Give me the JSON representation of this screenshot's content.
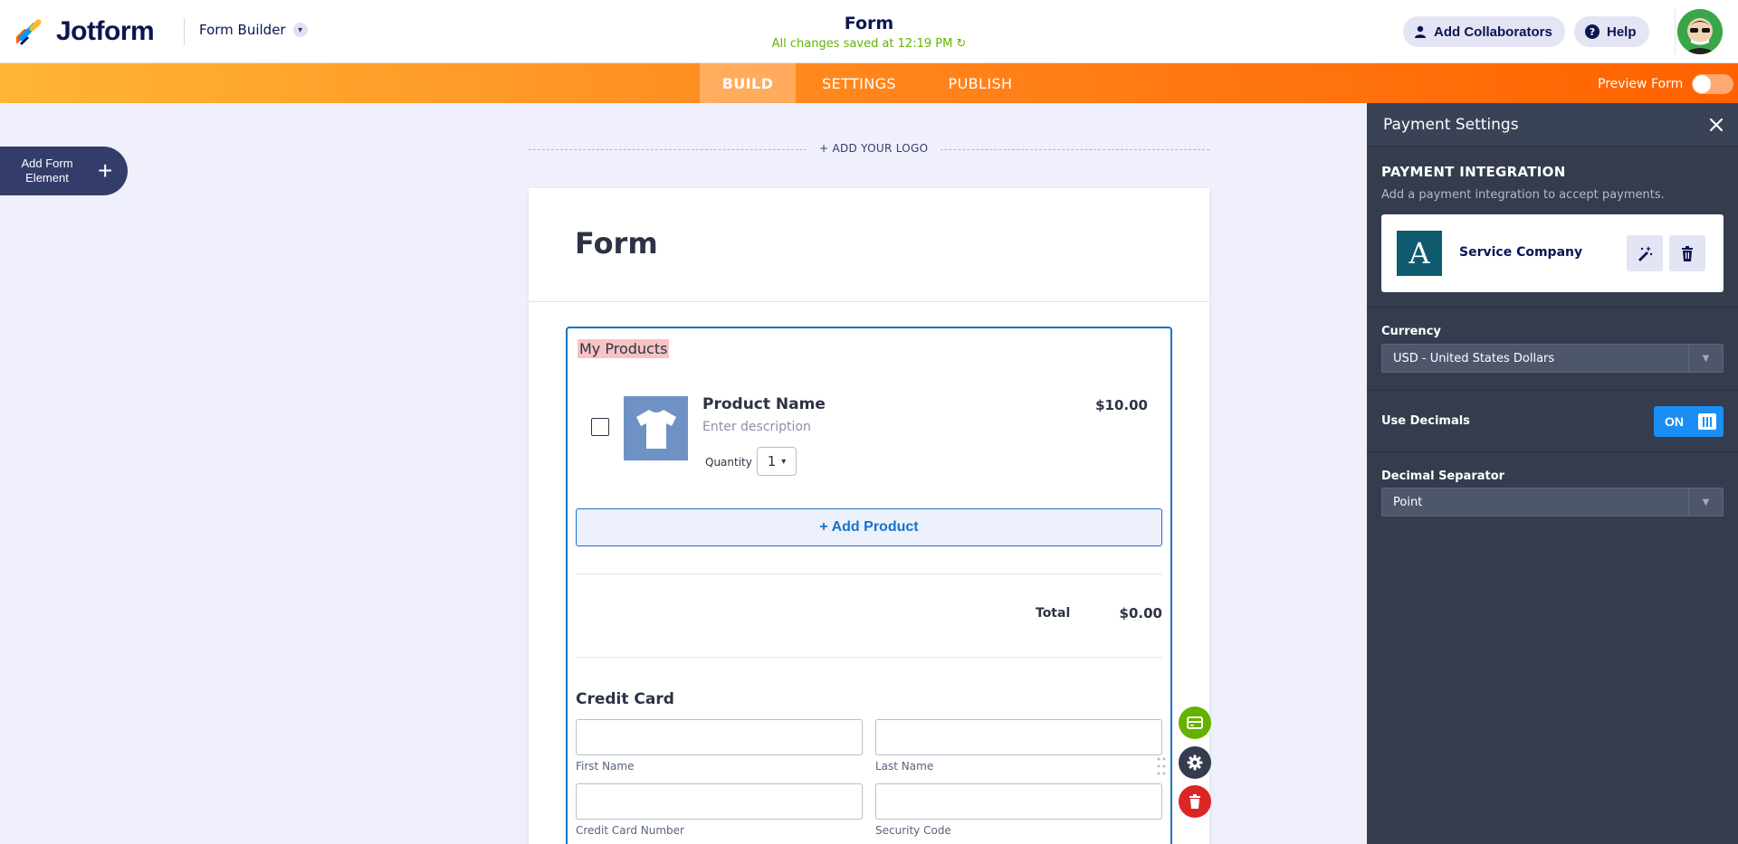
{
  "header": {
    "brand": "Jotform",
    "builder_menu": "Form Builder",
    "form_title": "Form",
    "saved_status": "All changes saved at 12:19 PM",
    "add_collaborators": "Add Collaborators",
    "help": "Help"
  },
  "nav": {
    "tabs": [
      {
        "label": "BUILD",
        "active": true
      },
      {
        "label": "SETTINGS",
        "active": false
      },
      {
        "label": "PUBLISH",
        "active": false
      }
    ],
    "preview_label": "Preview Form",
    "preview_on": false
  },
  "left": {
    "add_element_line1": "Add Form",
    "add_element_line2": "Element"
  },
  "form": {
    "add_logo": "+ ADD YOUR LOGO",
    "heading": "Form",
    "products": {
      "label": "My Products",
      "product_name": "Product Name",
      "description": "Enter description",
      "quantity_label": "Quantity",
      "quantity_value": "1",
      "price": "$10.00",
      "add_product": "+ Add Product",
      "total_label": "Total",
      "total_value": "$0.00"
    },
    "credit_card": {
      "title": "Credit Card",
      "first_name": "First Name",
      "last_name": "Last Name",
      "card_number": "Credit Card Number",
      "security_code": "Security Code"
    }
  },
  "panel": {
    "title": "Payment Settings",
    "integration_title": "PAYMENT INTEGRATION",
    "integration_sub": "Add a payment integration to accept payments.",
    "provider_letter": "A",
    "provider_name": "Service Company",
    "currency_label": "Currency",
    "currency_value": "USD - United States Dollars",
    "decimals_label": "Use Decimals",
    "decimals_state": "ON",
    "separator_label": "Decimal Separator",
    "separator_value": "Point"
  },
  "colors": {
    "brand_navy": "#0a1551",
    "nav_orange_start": "#ffb537",
    "nav_orange_end": "#ff6100",
    "saved_green": "#64b200",
    "selection_blue": "#1673ca",
    "panel_bg": "#343c4e",
    "toggle_blue": "#1a8ef5",
    "fab_green": "#64b200",
    "fab_red": "#dc2626"
  }
}
